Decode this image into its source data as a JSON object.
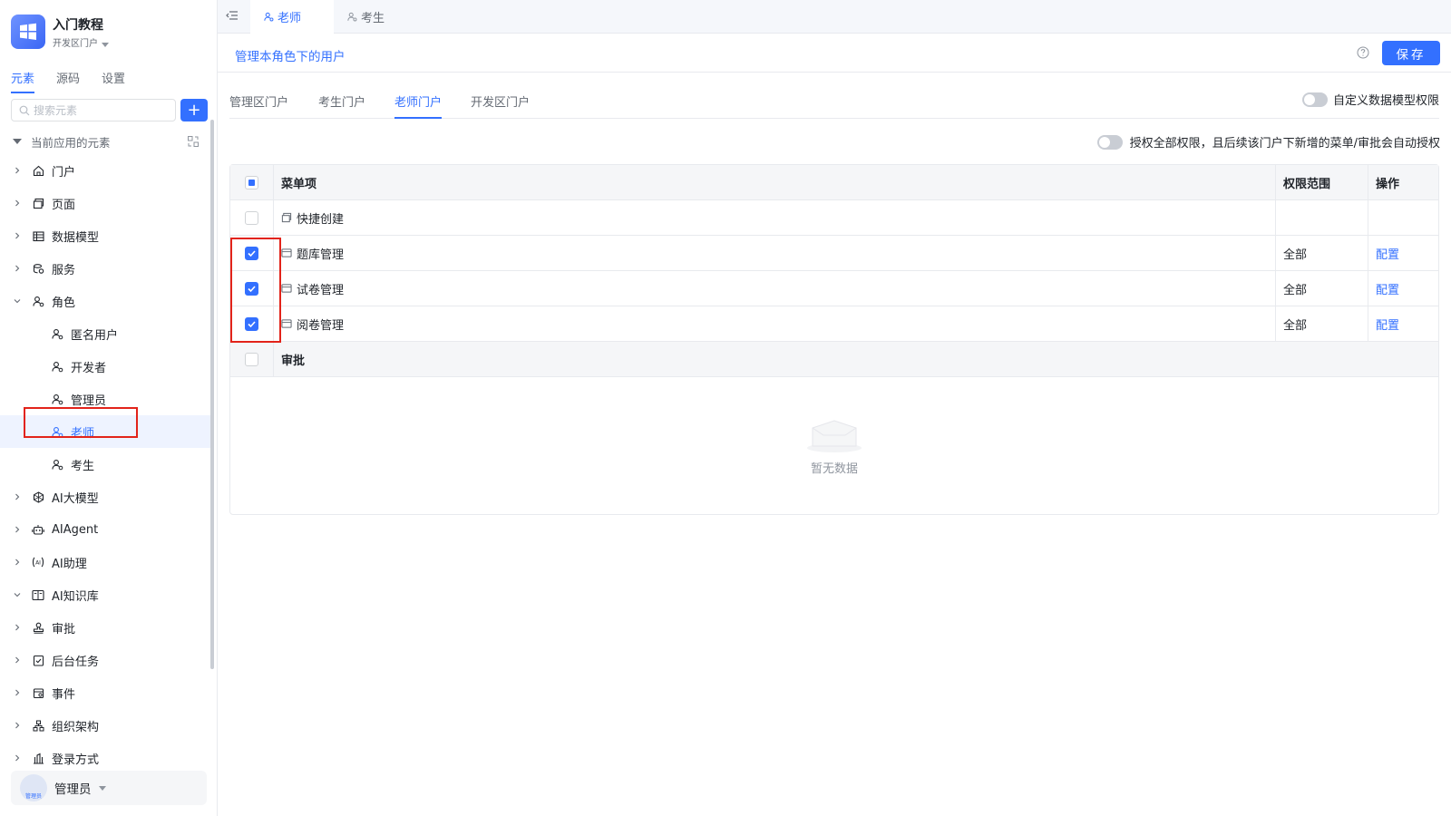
{
  "app": {
    "title": "入门教程",
    "portal": "开发区门户"
  },
  "sidebar": {
    "tabs": [
      {
        "label": "元素",
        "active": true
      },
      {
        "label": "源码",
        "active": false
      },
      {
        "label": "设置",
        "active": false
      }
    ],
    "search_placeholder": "搜索元素",
    "add_label": "+",
    "tree_header": "当前应用的元素",
    "tree": [
      {
        "label": "门户",
        "icon": "home-icon",
        "expanded": false
      },
      {
        "label": "页面",
        "icon": "page-icon",
        "expanded": false
      },
      {
        "label": "数据模型",
        "icon": "table-icon",
        "expanded": false
      },
      {
        "label": "服务",
        "icon": "service-icon",
        "expanded": false
      },
      {
        "label": "角色",
        "icon": "role-icon",
        "expanded": true,
        "children": [
          "匿名用户",
          "开发者",
          "管理员",
          "老师",
          "考生"
        ]
      },
      {
        "label": "AI大模型",
        "icon": "ai-model-icon",
        "expanded": false
      },
      {
        "label": "AIAgent",
        "icon": "robot-icon",
        "expanded": false
      },
      {
        "label": "AI助理",
        "icon": "ai-assistant-icon",
        "expanded": false
      },
      {
        "label": "AI知识库",
        "icon": "book-icon",
        "expanded": true
      },
      {
        "label": "审批",
        "icon": "stamp-icon",
        "expanded": false
      },
      {
        "label": "后台任务",
        "icon": "task-icon",
        "expanded": false
      },
      {
        "label": "事件",
        "icon": "event-icon",
        "expanded": false
      },
      {
        "label": "组织架构",
        "icon": "org-icon",
        "expanded": false
      },
      {
        "label": "登录方式",
        "icon": "login-icon",
        "expanded": false
      }
    ],
    "selected_child": "老师",
    "user": {
      "name": "管理员",
      "avatar_text": "管理员"
    }
  },
  "topbar": {
    "tabs": [
      {
        "label": "老师",
        "active": true
      },
      {
        "label": "考生",
        "active": false
      }
    ]
  },
  "header": {
    "manage_link": "管理本角色下的用户",
    "save_label": "保存"
  },
  "portal_tabs": [
    {
      "label": "管理区门户",
      "active": false
    },
    {
      "label": "考生门户",
      "active": false
    },
    {
      "label": "老师门户",
      "active": true
    },
    {
      "label": "开发区门户",
      "active": false
    }
  ],
  "custom_perm_label": "自定义数据模型权限",
  "auth_all_label": "授权全部权限，且后续该门户下新增的菜单/审批会自动授权",
  "table": {
    "columns": [
      "菜单项",
      "权限范围",
      "操作"
    ],
    "rows": [
      {
        "label": "快捷创建",
        "checked": false,
        "scope": "",
        "op": ""
      },
      {
        "label": "题库管理",
        "checked": true,
        "scope": "全部",
        "op": "配置"
      },
      {
        "label": "试卷管理",
        "checked": true,
        "scope": "全部",
        "op": "配置"
      },
      {
        "label": "阅卷管理",
        "checked": true,
        "scope": "全部",
        "op": "配置"
      }
    ],
    "approval_label": "审批",
    "empty_text": "暂无数据"
  },
  "colors": {
    "accent": "#3370ff",
    "highlight": "#e2231a"
  }
}
